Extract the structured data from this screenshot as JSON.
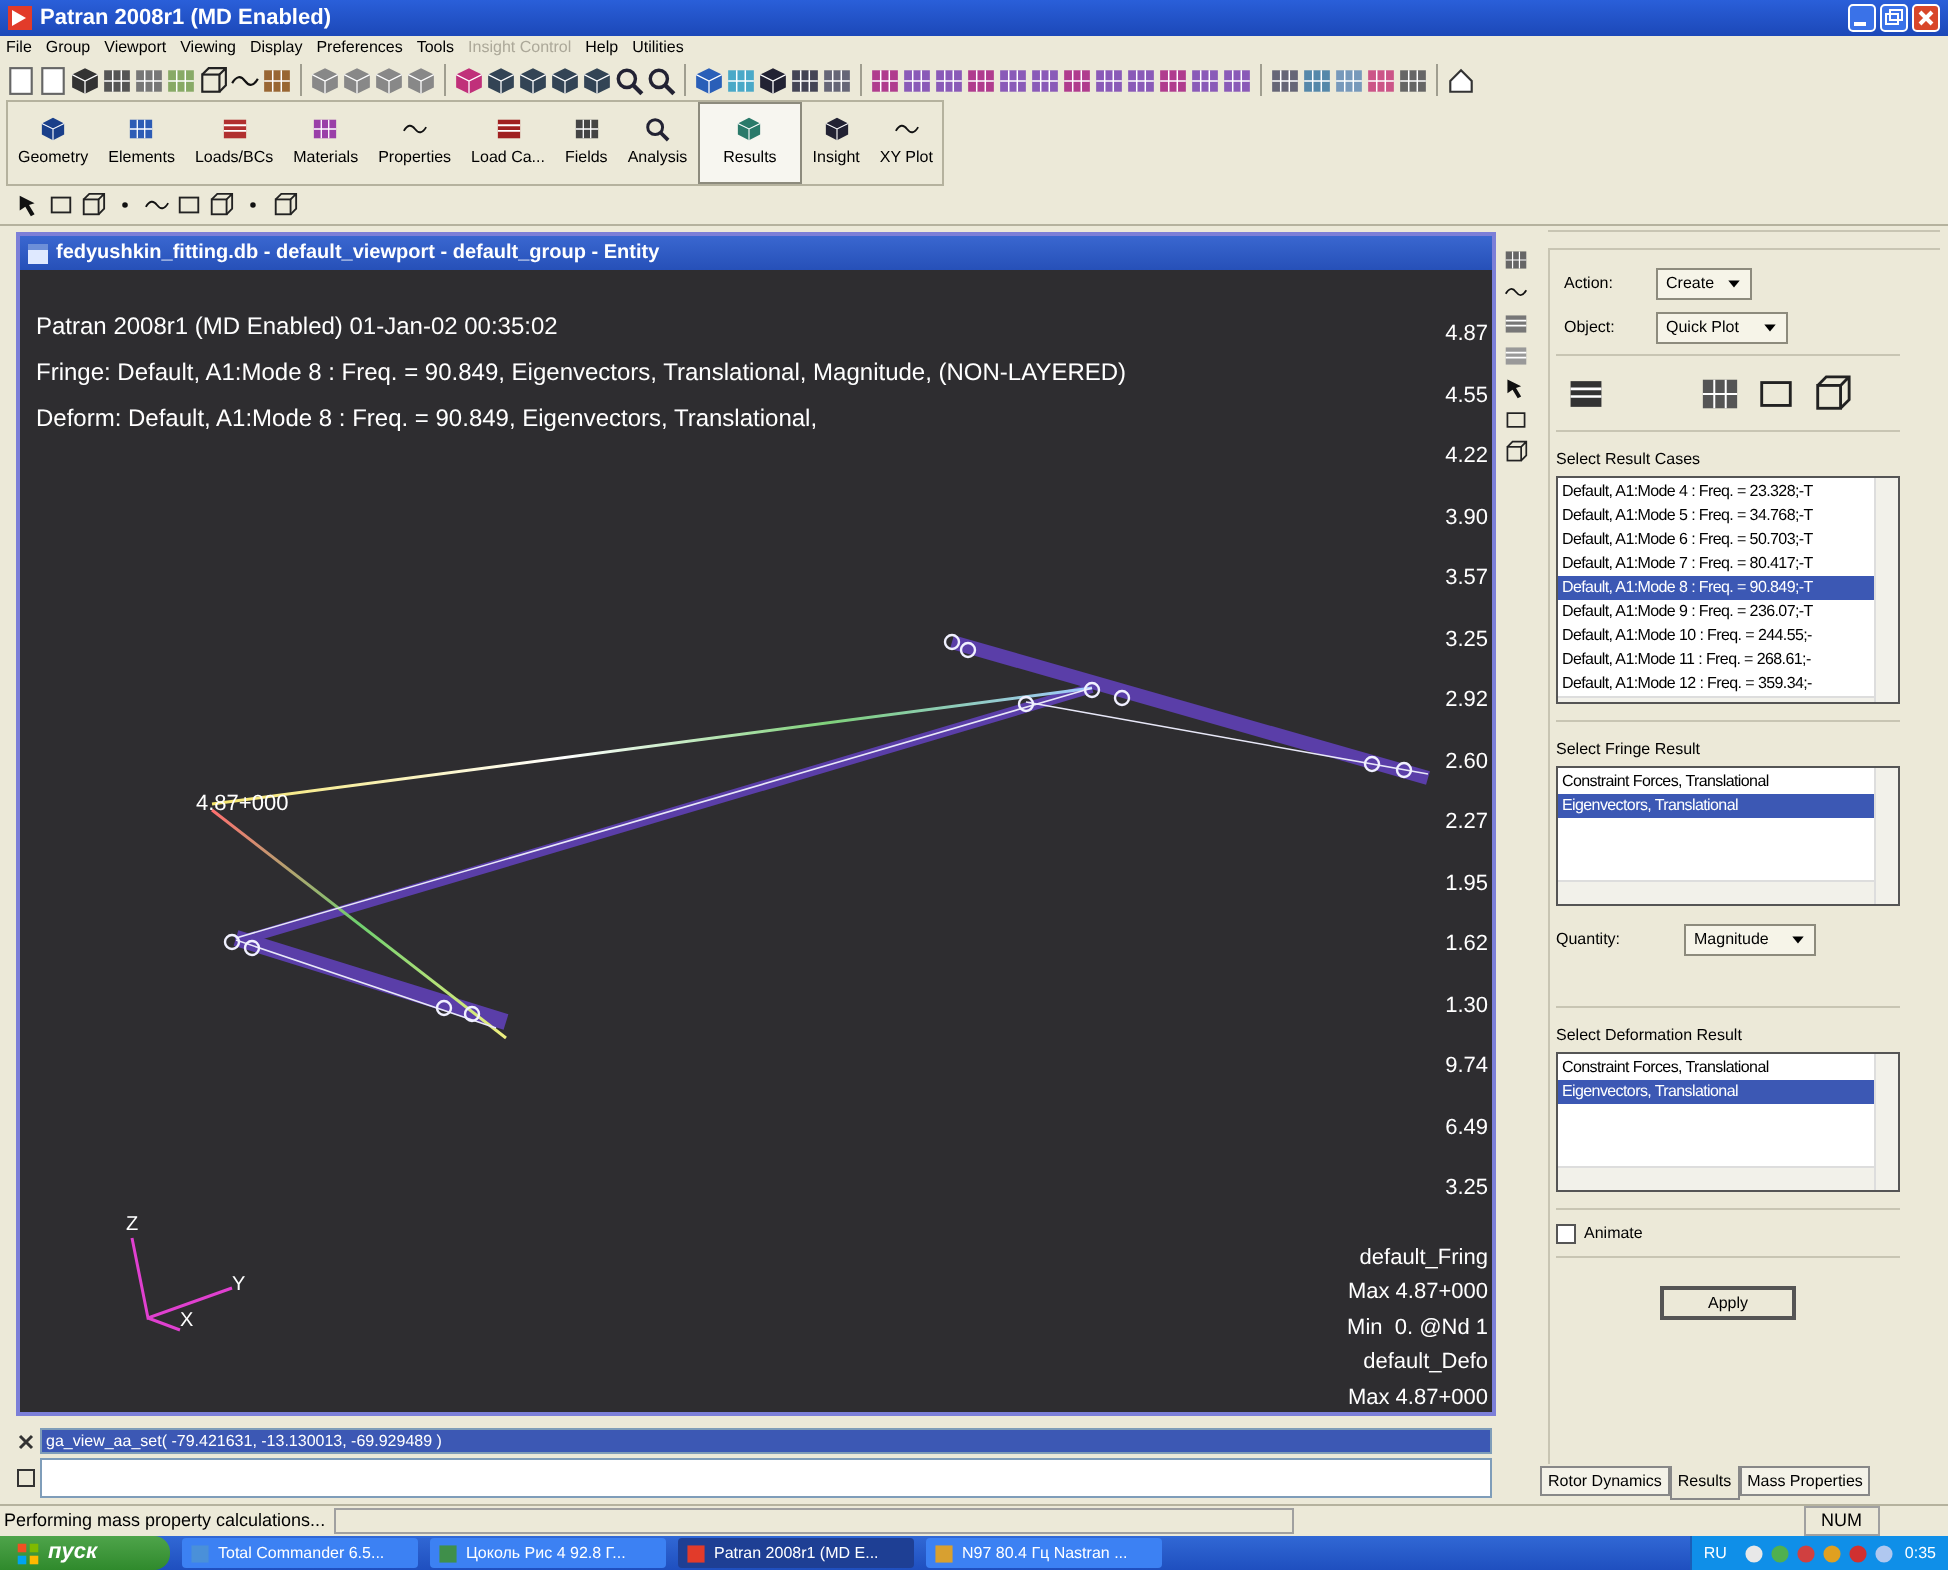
{
  "window": {
    "title": "Patran 2008r1 (MD Enabled)"
  },
  "menu": [
    {
      "label": "File",
      "disabled": false
    },
    {
      "label": "Group",
      "disabled": false
    },
    {
      "label": "Viewport",
      "disabled": false
    },
    {
      "label": "Viewing",
      "disabled": false
    },
    {
      "label": "Display",
      "disabled": false
    },
    {
      "label": "Preferences",
      "disabled": false
    },
    {
      "label": "Tools",
      "disabled": false
    },
    {
      "label": "Insight Control",
      "disabled": true
    },
    {
      "label": "Help",
      "disabled": false
    },
    {
      "label": "Utilities",
      "disabled": false
    }
  ],
  "app_tabs": [
    {
      "label": "Geometry",
      "selected": false
    },
    {
      "label": "Elements",
      "selected": false
    },
    {
      "label": "Loads/BCs",
      "selected": false
    },
    {
      "label": "Materials",
      "selected": false
    },
    {
      "label": "Properties",
      "selected": false
    },
    {
      "label": "Load Ca...",
      "selected": false
    },
    {
      "label": "Fields",
      "selected": false
    },
    {
      "label": "Analysis",
      "selected": false
    },
    {
      "label": "Results",
      "selected": true
    },
    {
      "label": "Insight",
      "selected": false
    },
    {
      "label": "XY Plot",
      "selected": false
    }
  ],
  "viewport": {
    "title": "fedyushkin_fitting.db - default_viewport - default_group - Entity",
    "header_lines": [
      "Patran 2008r1 (MD Enabled) 01-Jan-02 00:35:02",
      "Fringe: Default, A1:Mode 8 : Freq. = 90.849, Eigenvectors, Translational, Magnitude, (NON-LAYERED)",
      "Deform: Default, A1:Mode 8 : Freq. = 90.849, Eigenvectors, Translational,"
    ],
    "legend_values": [
      "4.87",
      "4.55",
      "4.22",
      "3.90",
      "3.57",
      "3.25",
      "2.92",
      "2.60",
      "2.27",
      "1.95",
      "1.62",
      "1.30",
      "9.74",
      "6.49",
      "3.25"
    ],
    "node_label": "4.87+000",
    "info_lines": [
      "default_Fring",
      "Max 4.87+000",
      "Min  0. @Nd 1",
      "default_Defo",
      "Max 4.87+000"
    ],
    "axes": [
      "Z",
      "Y",
      "X"
    ]
  },
  "panel": {
    "action_label": "Action:",
    "action": "Create",
    "object_label": "Object:",
    "object": "Quick Plot",
    "result_cases_label": "Select Result Cases",
    "result_cases": [
      {
        "label": "Default, A1:Mode 4 : Freq. = 23.328;-T",
        "selected": false
      },
      {
        "label": "Default, A1:Mode 5 : Freq. = 34.768;-T",
        "selected": false
      },
      {
        "label": "Default, A1:Mode 6 : Freq. = 50.703;-T",
        "selected": false
      },
      {
        "label": "Default, A1:Mode 7 : Freq. = 80.417;-T",
        "selected": false
      },
      {
        "label": "Default, A1:Mode 8 : Freq. = 90.849;-T",
        "selected": true
      },
      {
        "label": "Default, A1:Mode 9 : Freq. = 236.07;-T",
        "selected": false
      },
      {
        "label": "Default, A1:Mode 10 : Freq. = 244.55;-",
        "selected": false
      },
      {
        "label": "Default, A1:Mode 11 : Freq. = 268.61;-",
        "selected": false
      },
      {
        "label": "Default, A1:Mode 12 : Freq. = 359.34;-",
        "selected": false
      }
    ],
    "fringe_label": "Select Fringe Result",
    "fringe_results": [
      {
        "label": "Constraint Forces, Translational",
        "selected": false
      },
      {
        "label": "Eigenvectors, Translational",
        "selected": true
      }
    ],
    "quantity_label": "Quantity:",
    "quantity": "Magnitude",
    "deformation_label": "Select Deformation Result",
    "deformation_results": [
      {
        "label": "Constraint Forces, Translational",
        "selected": false
      },
      {
        "label": "Eigenvectors, Translational",
        "selected": true
      }
    ],
    "animate": {
      "label": "Animate",
      "checked": false
    },
    "apply": "Apply"
  },
  "panel_tabs": [
    {
      "label": "Rotor Dynamics",
      "selected": false
    },
    {
      "label": "Results",
      "selected": true
    },
    {
      "label": "Mass Properties",
      "selected": false
    }
  ],
  "command": {
    "history": [
      {
        "label": "ga_view_aa_set( -79.421631, -13.130013, -69.929489 )",
        "selected": true
      }
    ]
  },
  "status": {
    "message": "Performing mass property calculations...",
    "indicator": "NUM"
  },
  "taskbar": {
    "start": "пуск",
    "tasks": [
      {
        "label": "Total Commander 6.5...",
        "active": false
      },
      {
        "label": "Цоколь Рис 4 92.8 Г...",
        "active": false
      },
      {
        "label": "Patran 2008r1 (MD E...",
        "active": true
      },
      {
        "label": "N97 80.4 Гц Nastran ...",
        "active": false
      }
    ],
    "language": "RU",
    "clock": "0:35"
  }
}
